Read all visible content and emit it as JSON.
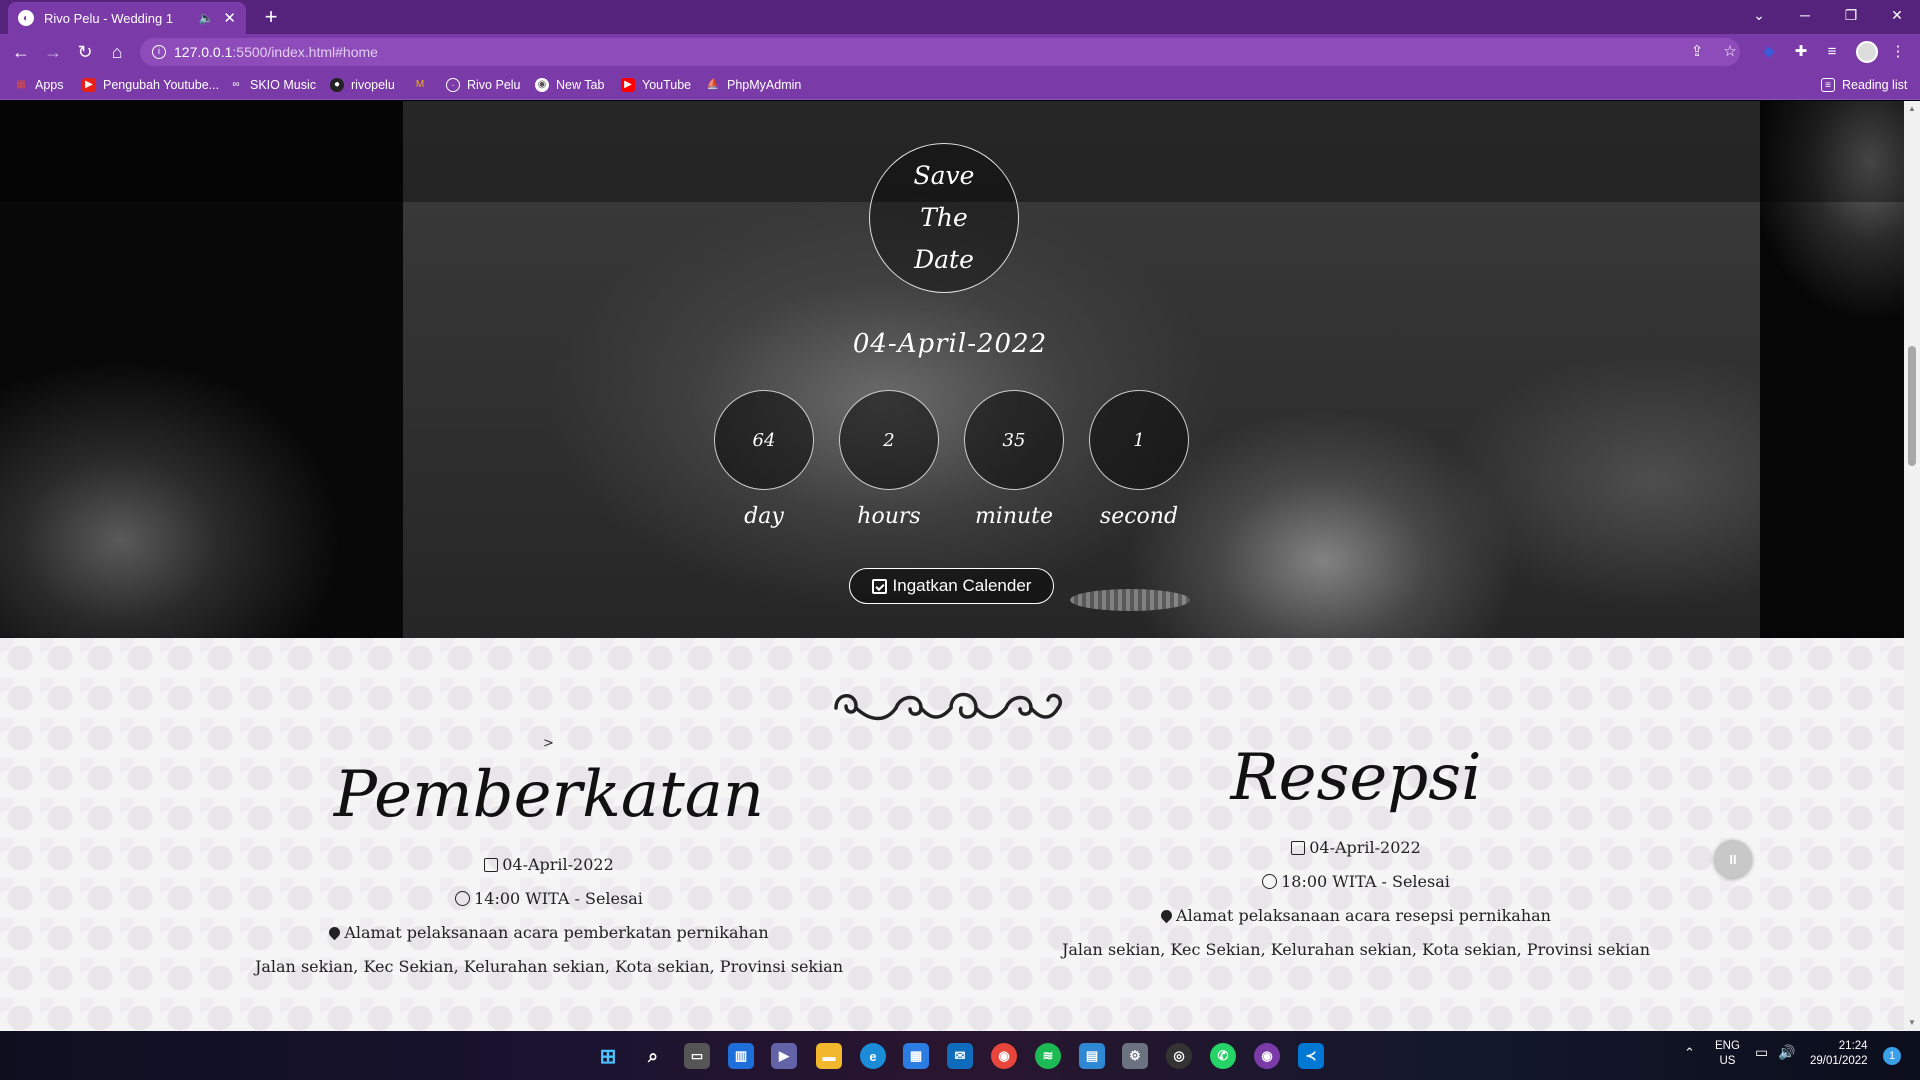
{
  "browser": {
    "tab_title": "Rivo Pelu - Wedding 1",
    "tab_mute": "🔈",
    "tab_close": "✕",
    "new_tab": "+",
    "url_host": "127.0.0.1",
    "url_path": ":5500/index.html#home",
    "reading_list": "Reading list",
    "bookmarks": [
      {
        "label": "Apps",
        "icon": "apps-grid-icon",
        "color": "#e04a3a"
      },
      {
        "label": "Pengubah Youtube...",
        "icon": "youtube-red-icon",
        "color": "#e62117"
      },
      {
        "label": "SKIO Music",
        "icon": "infinity-icon",
        "color": "#333333"
      },
      {
        "label": "rivopelu",
        "icon": "github-icon",
        "color": "#222222"
      },
      {
        "label": "",
        "icon": "gmail-icon",
        "color": "#d44638"
      },
      {
        "label": "Rivo Pelu",
        "icon": "rivo-globe-icon",
        "color": "#444444"
      },
      {
        "label": "New Tab",
        "icon": "chrome-newtab-icon",
        "color": "#444444"
      },
      {
        "label": "YouTube",
        "icon": "youtube-icon",
        "color": "#ff0000"
      },
      {
        "label": "PhpMyAdmin",
        "icon": "phpmyadmin-icon",
        "color": "#f29111"
      }
    ]
  },
  "hero": {
    "save_the_date": "Save The Date",
    "date": "04-April-2022",
    "countdown": [
      {
        "value": "64",
        "label": "day"
      },
      {
        "value": "2",
        "label": "hours"
      },
      {
        "value": "35",
        "label": "minute"
      },
      {
        "value": "1",
        "label": "second"
      }
    ],
    "calendar_button": "Ingatkan Calender"
  },
  "events": {
    "marker": ">",
    "pemberkatan": {
      "title": "Pemberkatan",
      "date": "04-April-2022",
      "time": "14:00 WITA - Selesai",
      "place": "Alamat pelaksanaan acara pemberkatan pernikahan",
      "address": "Jalan sekian, Kec Sekian, Kelurahan sekian, Kota sekian, Provinsi sekian"
    },
    "resepsi": {
      "title": "Resepsi",
      "date": "04-April-2022",
      "time": "18:00 WITA - Selesai",
      "place": "Alamat pelaksanaan acara resepsi pernikahan",
      "address": "Jalan sekian, Kec Sekian, Kelurahan sekian, Kota sekian, Provinsi sekian"
    }
  },
  "music_button": "II",
  "taskbar": {
    "lang_1": "ENG",
    "lang_2": "US",
    "time": "21:24",
    "date": "29/01/2022",
    "notifications": "1"
  },
  "colors": {
    "browser_accent": "#7a3aa8",
    "tab_strip": "#55237b"
  }
}
